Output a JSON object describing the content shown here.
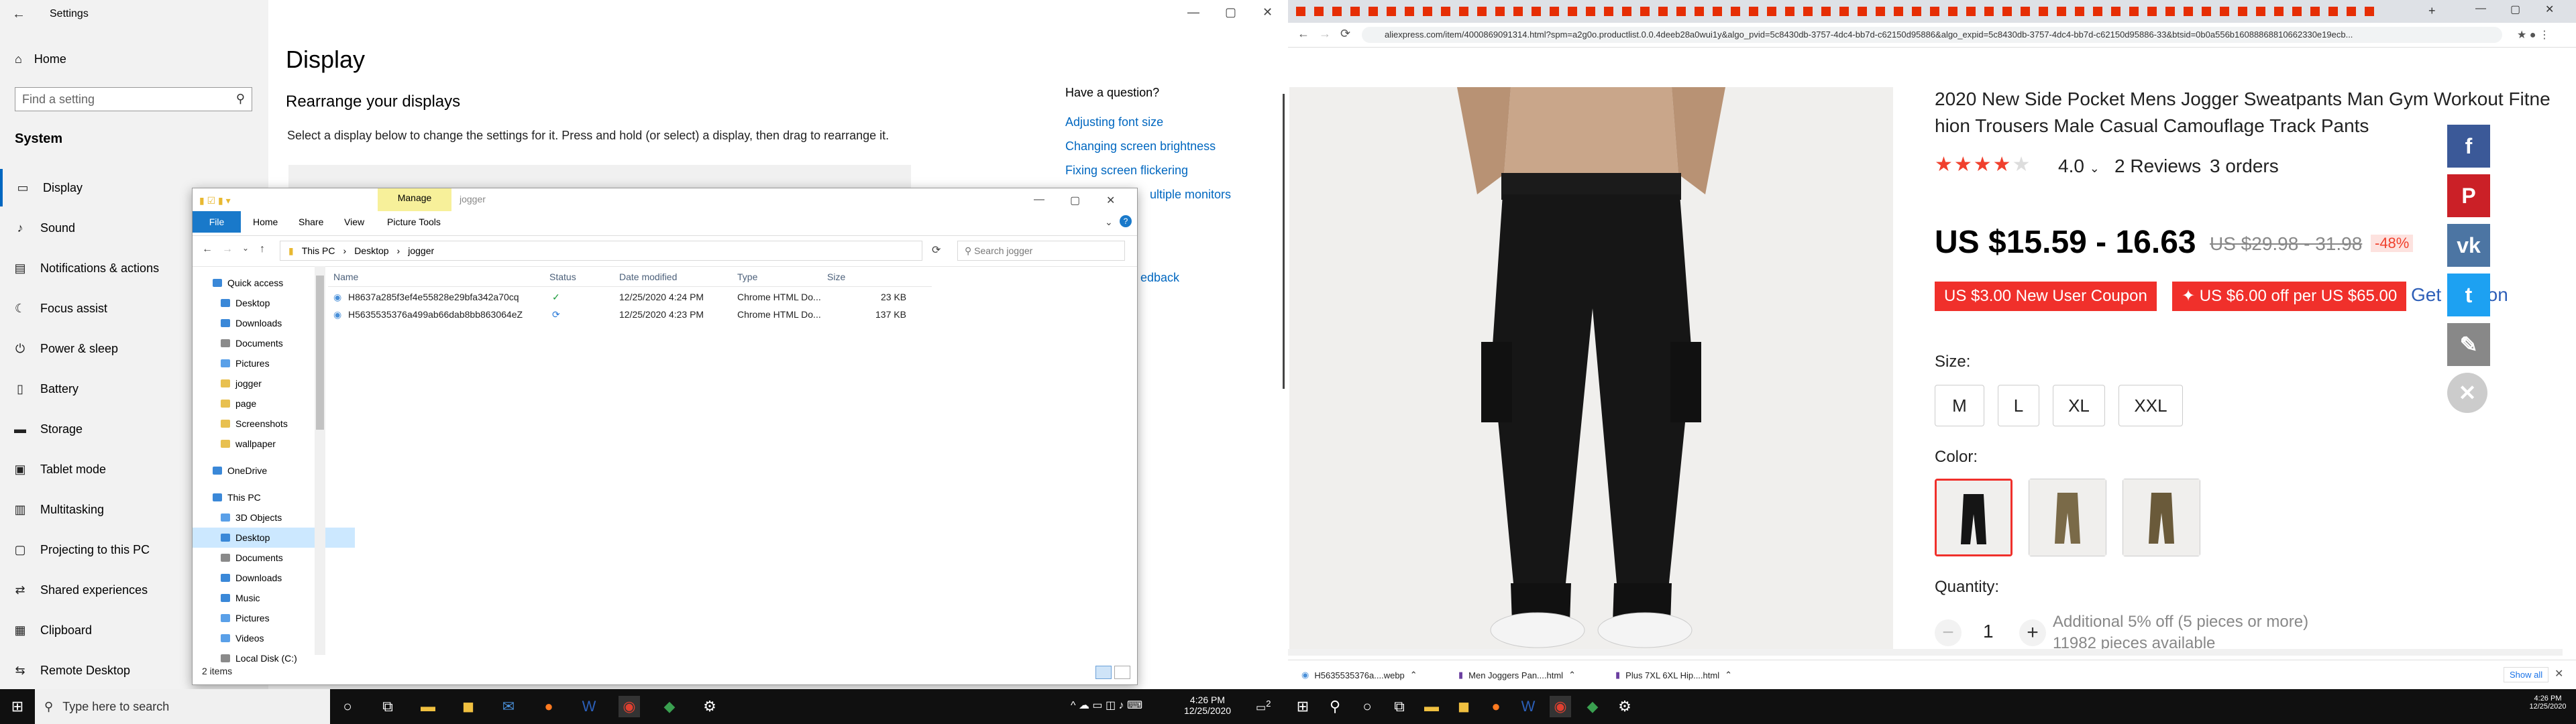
{
  "settings": {
    "window_title": "Settings",
    "home_label": "Home",
    "search_placeholder": "Find a setting",
    "section_label": "System",
    "nav_items": [
      {
        "label": "Display",
        "icon": "monitor-icon"
      },
      {
        "label": "Sound",
        "icon": "speaker-icon"
      },
      {
        "label": "Notifications & actions",
        "icon": "notifications-icon"
      },
      {
        "label": "Focus assist",
        "icon": "moon-icon"
      },
      {
        "label": "Power & sleep",
        "icon": "power-icon"
      },
      {
        "label": "Battery",
        "icon": "battery-icon"
      },
      {
        "label": "Storage",
        "icon": "storage-icon"
      },
      {
        "label": "Tablet mode",
        "icon": "tablet-icon"
      },
      {
        "label": "Multitasking",
        "icon": "multitasking-icon"
      },
      {
        "label": "Projecting to this PC",
        "icon": "projector-icon"
      },
      {
        "label": "Shared experiences",
        "icon": "shared-icon"
      },
      {
        "label": "Clipboard",
        "icon": "clipboard-icon"
      },
      {
        "label": "Remote Desktop",
        "icon": "remote-desktop-icon"
      }
    ],
    "page_title": "Display",
    "rearrange_heading": "Rearrange your displays",
    "rearrange_desc": "Select a display below to change the settings for it. Press and hold (or select) a display, then drag to rearrange it.",
    "question_heading": "Have a question?",
    "help_links": [
      "Adjusting font size",
      "Changing screen brightness",
      "Fixing screen flickering",
      "ultiple monitors",
      "edback"
    ]
  },
  "explorer": {
    "manage_label": "Manage",
    "title": "jogger",
    "tabs": [
      "File",
      "Home",
      "Share",
      "View",
      "Picture Tools"
    ],
    "breadcrumb": [
      "This PC",
      "Desktop",
      "jogger"
    ],
    "search_placeholder": "Search jogger",
    "nav_items": [
      {
        "label": "Quick access",
        "color": "#3a88d8"
      },
      {
        "label": "Desktop",
        "color": "#3a88d8"
      },
      {
        "label": "Downloads",
        "color": "#3a88d8"
      },
      {
        "label": "Documents",
        "color": "#8a8a8a"
      },
      {
        "label": "Pictures",
        "color": "#5aa0e8"
      },
      {
        "label": "jogger",
        "color": "#e8c050"
      },
      {
        "label": "page",
        "color": "#e8c050"
      },
      {
        "label": "Screenshots",
        "color": "#e8c050"
      },
      {
        "label": "wallpaper",
        "color": "#e8c050"
      },
      {
        "label": "OneDrive",
        "color": "#3a88d8"
      },
      {
        "label": "This PC",
        "color": "#3a88d8"
      },
      {
        "label": "3D Objects",
        "color": "#5aa0e8"
      },
      {
        "label": "Desktop",
        "color": "#3a88d8"
      },
      {
        "label": "Documents",
        "color": "#8a8a8a"
      },
      {
        "label": "Downloads",
        "color": "#3a88d8"
      },
      {
        "label": "Music",
        "color": "#3a88d8"
      },
      {
        "label": "Pictures",
        "color": "#5aa0e8"
      },
      {
        "label": "Videos",
        "color": "#5aa0e8"
      },
      {
        "label": "Local Disk (C:)",
        "color": "#8a8a8a"
      }
    ],
    "columns": [
      "Name",
      "Status",
      "Date modified",
      "Type",
      "Size"
    ],
    "files": [
      {
        "name": "H8637a285f3ef4e55828e29bfa342a70cq",
        "status": "✓",
        "date": "12/25/2020 4:24 PM",
        "type": "Chrome HTML Do...",
        "size": "23 KB"
      },
      {
        "name": "H5635535376a499ab66dab8bb863064eZ",
        "status": "⟳",
        "date": "12/25/2020 4:23 PM",
        "type": "Chrome HTML Do...",
        "size": "137 KB"
      }
    ],
    "status_text": "2 items"
  },
  "taskbar": {
    "search_placeholder": "Type here to search",
    "time": "4:26 PM",
    "date": "12/25/2020",
    "notification_count": "2"
  },
  "browser": {
    "url": "aliexpress.com/item/4000869091314.html?spm=a2g0o.productlist.0.0.4deeb28a0wui1y&algo_pvid=5c8430db-3757-4dc4-bb7d-c62150d95886&algo_expid=5c8430db-3757-4dc4-bb7d-c62150d95886-33&btsid=0b0a556b16088868810662330e19ecb...",
    "product_title": "2020 New Side Pocket Mens Jogger Sweatpants Man Gym Workout Fitness Cotton Trousers Male Casual Camouflage Track Pants",
    "product_title_display_l1": "2020 New Side Pocket Mens Jogger Sweatpants Man Gym Workout Fitne",
    "product_title_display_l2": "hion Trousers Male Casual Camouflage Track Pants",
    "rating": "4.0",
    "rating_stars": 4,
    "reviews": "2 Reviews",
    "orders": "3 orders",
    "price": "US $15.59 - 16.63",
    "old_price": "US $29.98 - 31.98",
    "discount": "-48%",
    "coupon1": "US $3.00 New User Coupon",
    "coupon2": "✦ US $6.00 off per US $65.00",
    "get_coupons": "Get coupon",
    "size_label": "Size:",
    "sizes": [
      "M",
      "L",
      "XL",
      "XXL"
    ],
    "color_label": "Color:",
    "quantity_label": "Quantity:",
    "quantity": "1",
    "additional_discount": "Additional 5% off (5 pieces or more)",
    "pieces_available": "11982 pieces available",
    "downloads": [
      {
        "name": "H5635535376a....webp",
        "icon_color": "#4a90d9"
      },
      {
        "name": "Men Joggers Pan....html",
        "icon_color": "#6b3fa0"
      },
      {
        "name": "Plus 7XL 6XL Hip....html",
        "icon_color": "#6b3fa0"
      }
    ],
    "show_all": "Show all",
    "share_buttons": [
      {
        "name": "facebook",
        "color": "#3b5998",
        "glyph": "f"
      },
      {
        "name": "pinterest",
        "color": "#cb2027",
        "glyph": "P"
      },
      {
        "name": "vk",
        "color": "#4c75a3",
        "glyph": "vk"
      },
      {
        "name": "twitter",
        "color": "#1da1f2",
        "glyph": "t"
      },
      {
        "name": "edit",
        "color": "#888888",
        "glyph": "✎"
      },
      {
        "name": "close",
        "color": "#cccccc",
        "glyph": "✕"
      }
    ],
    "time": "4:26 PM",
    "date": "12/25/2020"
  }
}
